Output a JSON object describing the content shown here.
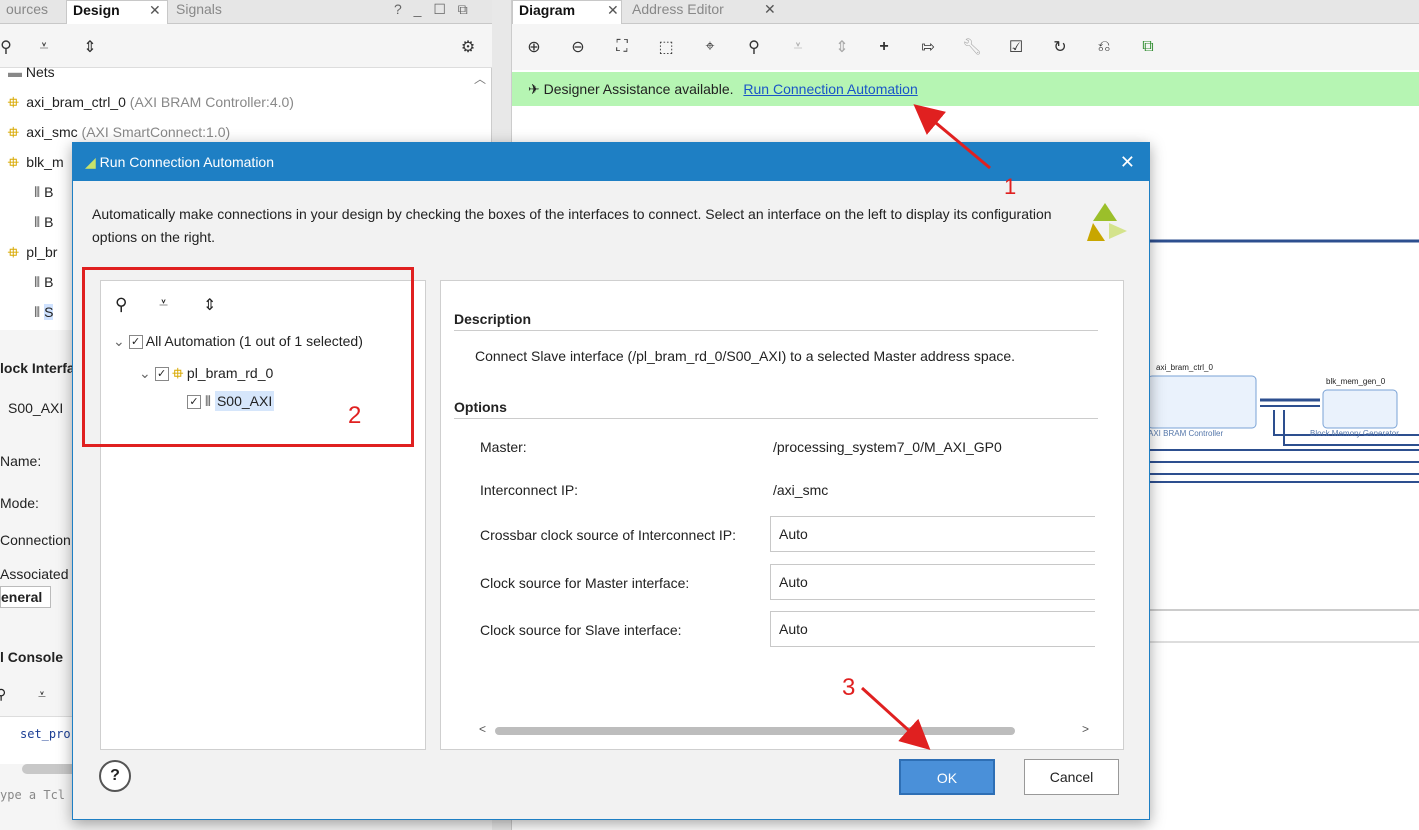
{
  "left_tabs": {
    "sources": "ources",
    "design": "Design",
    "signals": "Signals",
    "controls": "? _ ☐ ⧉"
  },
  "right_tabs": {
    "diagram": "Diagram",
    "address_editor": "Address Editor"
  },
  "tree": {
    "nets": "Nets",
    "items": [
      {
        "name": "axi_bram_ctrl_0",
        "detail": "(AXI BRAM Controller:4.0)"
      },
      {
        "name": "axi_smc",
        "detail": "(AXI SmartConnect:1.0)"
      },
      {
        "name": "blk_m",
        "detail": ""
      },
      {
        "name": "B",
        "detail": ""
      },
      {
        "name": "B",
        "detail": ""
      },
      {
        "name": "pl_br",
        "detail": ""
      },
      {
        "name": "B",
        "detail": ""
      },
      {
        "name": "S",
        "detail": ""
      }
    ]
  },
  "left_panel": {
    "block_interface": "lock Interfa",
    "s00": "S00_AXI",
    "name": "Name:",
    "mode": "Mode:",
    "connection": "Connection",
    "associated": "Associated",
    "general": "eneral",
    "tcl_console": "l Console",
    "tcl_text": "set_pro",
    "tcl_input": "ype a Tcl"
  },
  "banner": {
    "text": "Designer Assistance available.",
    "link": "Run Connection Automation"
  },
  "diagram": {
    "block1_title": "axi_bram_ctrl_0",
    "block1_label": "AXI BRAM Controller",
    "block2_title": "blk_mem_gen_0",
    "block2_label": "Block Memory Generator"
  },
  "dialog": {
    "title": "Run Connection Automation",
    "description_text": "Automatically make connections in your design by checking the boxes of the interfaces to connect. Select an interface on the left to display its configuration options on the right.",
    "tree": {
      "root": "All Automation (1 out of 1 selected)",
      "child": "pl_bram_rd_0",
      "leaf": "S00_AXI"
    },
    "description_header": "Description",
    "description_body": "Connect Slave interface (/pl_bram_rd_0/S00_AXI) to a selected Master address space.",
    "options_header": "Options",
    "master_label": "Master:",
    "master_value": "/processing_system7_0/M_AXI_GP0",
    "interconnect_label": "Interconnect IP:",
    "interconnect_value": "/axi_smc",
    "crossbar_label": "Crossbar clock source of Interconnect IP:",
    "crossbar_value": "Auto",
    "master_clock_label": "Clock source for Master interface:",
    "master_clock_value": "Auto",
    "slave_clock_label": "Clock source for Slave interface:",
    "slave_clock_value": "Auto",
    "ok": "OK",
    "cancel": "Cancel",
    "help": "?"
  },
  "annotations": {
    "a1": "1",
    "a2": "2",
    "a3": "3"
  },
  "colors": {
    "dialog_title_bg": "#1e7fc4",
    "banner_bg": "#b6f5b3",
    "ok_bg": "#4a90d9",
    "annotation_red": "#e02020",
    "wire_blue": "#2d4f8f"
  }
}
